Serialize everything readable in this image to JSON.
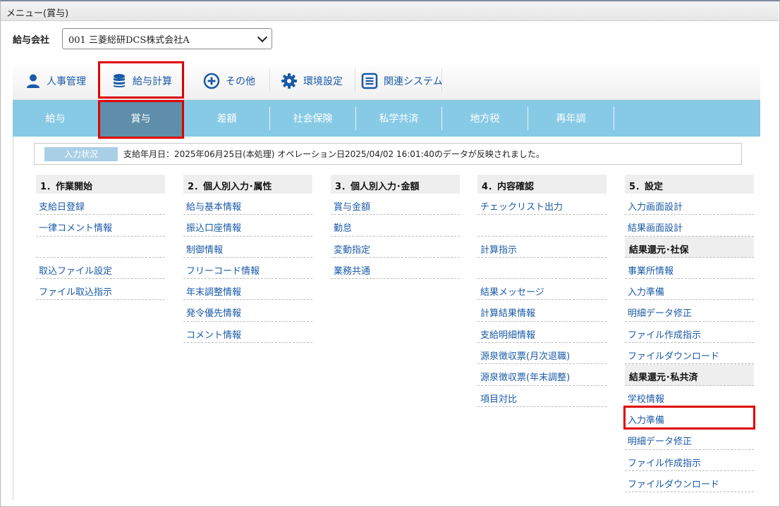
{
  "window": {
    "title": "メニュー(賞与)"
  },
  "company": {
    "label": "給与会社",
    "selected": "001 三菱総研DCS株式会社A"
  },
  "categories": [
    {
      "label": "人事管理",
      "icon": "person-icon"
    },
    {
      "label": "給与計算",
      "icon": "database-icon",
      "active": true
    },
    {
      "label": "その他",
      "icon": "plus-circle-icon"
    },
    {
      "label": "環境設定",
      "icon": "gear-icon"
    },
    {
      "label": "関連システム",
      "icon": "list-icon"
    }
  ],
  "tabs": [
    {
      "label": "給与"
    },
    {
      "label": "賞与",
      "active": true
    },
    {
      "label": "差額"
    },
    {
      "label": "社会保険"
    },
    {
      "label": "私学共済"
    },
    {
      "label": "地方税"
    },
    {
      "label": "再年調"
    }
  ],
  "status": {
    "badge": "入力状況",
    "text": "支給年月日：2025年06月25日(本処理) オペレーション日2025/04/02 16:01:40のデータが反映されました。"
  },
  "columns": [
    {
      "title": "1．作業開始",
      "items": [
        "支給日登録",
        "一律コメント情報",
        "",
        "取込ファイル設定",
        "ファイル取込指示"
      ]
    },
    {
      "title": "2．個人別入力･属性",
      "items": [
        "給与基本情報",
        "振込口座情報",
        "制御情報",
        "フリーコード情報",
        "年末調整情報",
        "発令優先情報",
        "コメント情報"
      ]
    },
    {
      "title": "3．個人別入力･金額",
      "items": [
        "賞与金額",
        "勤怠",
        "変動指定",
        "業務共通"
      ]
    },
    {
      "title": "4．内容確認",
      "items": [
        "チェックリスト出力",
        "",
        "計算指示",
        "",
        "結果メッセージ",
        "計算結果情報",
        "支給明細情報",
        "源泉徴収票(月次退職)",
        "源泉徴収票(年末調整)",
        "項目対比"
      ]
    },
    {
      "title": "5．設定",
      "items": [
        "入力画面設計",
        "結果画面設計"
      ],
      "groups": [
        {
          "title": "結果還元･社保",
          "items": [
            "事業所情報",
            "入力準備",
            "明細データ修正",
            "ファイル作成指示",
            "ファイルダウンロード"
          ]
        },
        {
          "title": "結果還元･私共済",
          "items": [
            "学校情報",
            "入力準備",
            "明細データ修正",
            "ファイル作成指示",
            "ファイルダウンロード"
          ]
        }
      ]
    }
  ],
  "colors": {
    "accent": "#1a5aa8",
    "tabbar": "#87cae6",
    "tab_active": "#5e8ea9",
    "highlight": "#e00000"
  }
}
